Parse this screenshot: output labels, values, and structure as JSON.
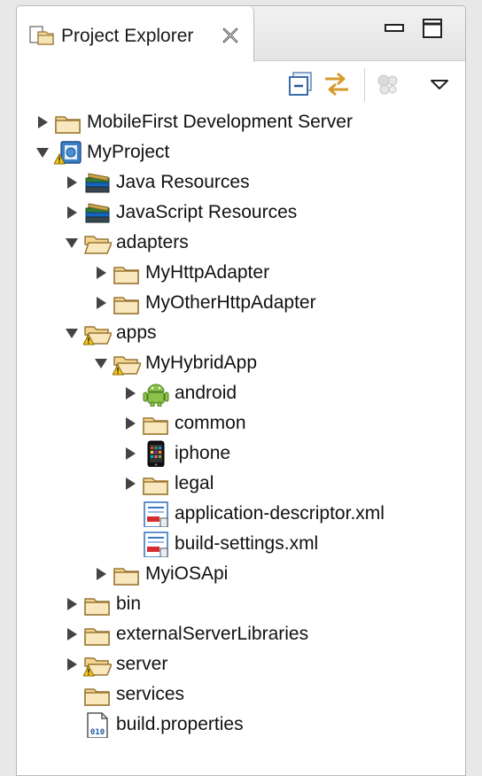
{
  "view": {
    "tab_title": "Project Explorer",
    "accent": "#3b78c2"
  },
  "tree": [
    {
      "label": "MobileFirst Development Server",
      "depth": 0,
      "arrow": "collapsed",
      "icon": "folder-icon"
    },
    {
      "label": "MyProject",
      "depth": 0,
      "arrow": "expanded",
      "icon": "project-warning-icon"
    },
    {
      "label": "Java Resources",
      "depth": 1,
      "arrow": "collapsed",
      "icon": "library-icon"
    },
    {
      "label": "JavaScript Resources",
      "depth": 1,
      "arrow": "collapsed",
      "icon": "library-icon"
    },
    {
      "label": "adapters",
      "depth": 1,
      "arrow": "expanded",
      "icon": "folder-open-icon"
    },
    {
      "label": "MyHttpAdapter",
      "depth": 2,
      "arrow": "collapsed",
      "icon": "folder-icon"
    },
    {
      "label": "MyOtherHttpAdapter",
      "depth": 2,
      "arrow": "collapsed",
      "icon": "folder-icon"
    },
    {
      "label": "apps",
      "depth": 1,
      "arrow": "expanded",
      "icon": "folder-warning-icon"
    },
    {
      "label": "MyHybridApp",
      "depth": 2,
      "arrow": "expanded",
      "icon": "folder-warning-icon"
    },
    {
      "label": "android",
      "depth": 3,
      "arrow": "collapsed",
      "icon": "android-icon"
    },
    {
      "label": "common",
      "depth": 3,
      "arrow": "collapsed",
      "icon": "folder-icon"
    },
    {
      "label": "iphone",
      "depth": 3,
      "arrow": "collapsed",
      "icon": "iphone-icon"
    },
    {
      "label": "legal",
      "depth": 3,
      "arrow": "collapsed",
      "icon": "folder-icon"
    },
    {
      "label": "application-descriptor.xml",
      "depth": 3,
      "arrow": "none",
      "icon": "xml-file-icon"
    },
    {
      "label": "build-settings.xml",
      "depth": 3,
      "arrow": "none",
      "icon": "xml-file-icon"
    },
    {
      "label": "MyiOSApi",
      "depth": 2,
      "arrow": "collapsed",
      "icon": "folder-icon"
    },
    {
      "label": "bin",
      "depth": 1,
      "arrow": "collapsed",
      "icon": "folder-icon"
    },
    {
      "label": "externalServerLibraries",
      "depth": 1,
      "arrow": "collapsed",
      "icon": "folder-icon"
    },
    {
      "label": "server",
      "depth": 1,
      "arrow": "collapsed",
      "icon": "folder-warning-icon"
    },
    {
      "label": "services",
      "depth": 1,
      "arrow": "none",
      "icon": "folder-icon"
    },
    {
      "label": "build.properties",
      "depth": 1,
      "arrow": "none",
      "icon": "properties-file-icon"
    }
  ]
}
